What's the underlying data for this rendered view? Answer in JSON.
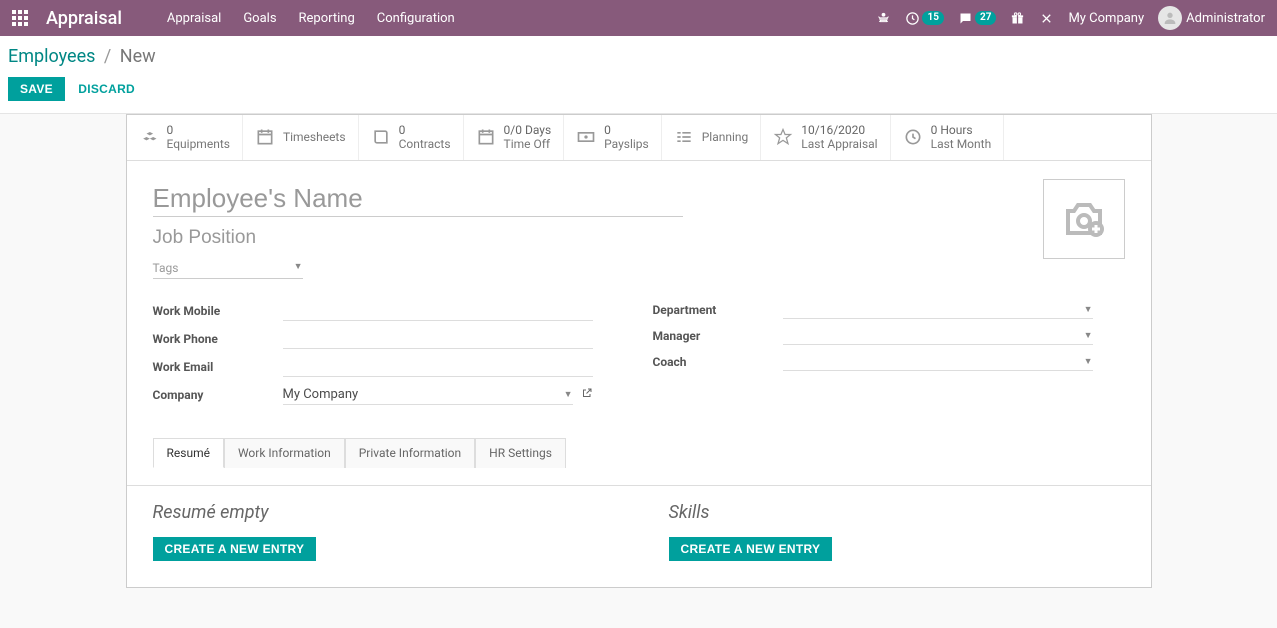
{
  "nav": {
    "app_title": "Appraisal",
    "menu": [
      "Appraisal",
      "Goals",
      "Reporting",
      "Configuration"
    ],
    "badge1": "15",
    "badge2": "27",
    "company": "My Company",
    "user": "Administrator"
  },
  "breadcrumb": {
    "root": "Employees",
    "current": "New"
  },
  "actions": {
    "save": "Save",
    "discard": "Discard"
  },
  "statbar": {
    "equip_val": "0",
    "equip_lbl": "Equipments",
    "timesheets_lbl": "Timesheets",
    "contracts_val": "0",
    "contracts_lbl": "Contracts",
    "timeoff_val": "0/0 Days",
    "timeoff_lbl": "Time Off",
    "payslips_val": "0",
    "payslips_lbl": "Payslips",
    "planning_lbl": "Planning",
    "appraisal_val": "10/16/2020",
    "appraisal_lbl": "Last Appraisal",
    "last_val": "0 Hours",
    "last_lbl": "Last Month"
  },
  "form": {
    "name_ph": "Employee's Name",
    "job_ph": "Job Position",
    "tags_ph": "Tags",
    "labels": {
      "work_mobile": "Work Mobile",
      "work_phone": "Work Phone",
      "work_email": "Work Email",
      "company": "Company",
      "department": "Department",
      "manager": "Manager",
      "coach": "Coach"
    },
    "company_value": "My Company"
  },
  "tabs": [
    "Resumé",
    "Work Information",
    "Private Information",
    "HR Settings"
  ],
  "resume": {
    "heading": "Resumé empty",
    "btn": "Create a New Entry"
  },
  "skills": {
    "heading": "Skills",
    "btn": "Create a New Entry"
  }
}
